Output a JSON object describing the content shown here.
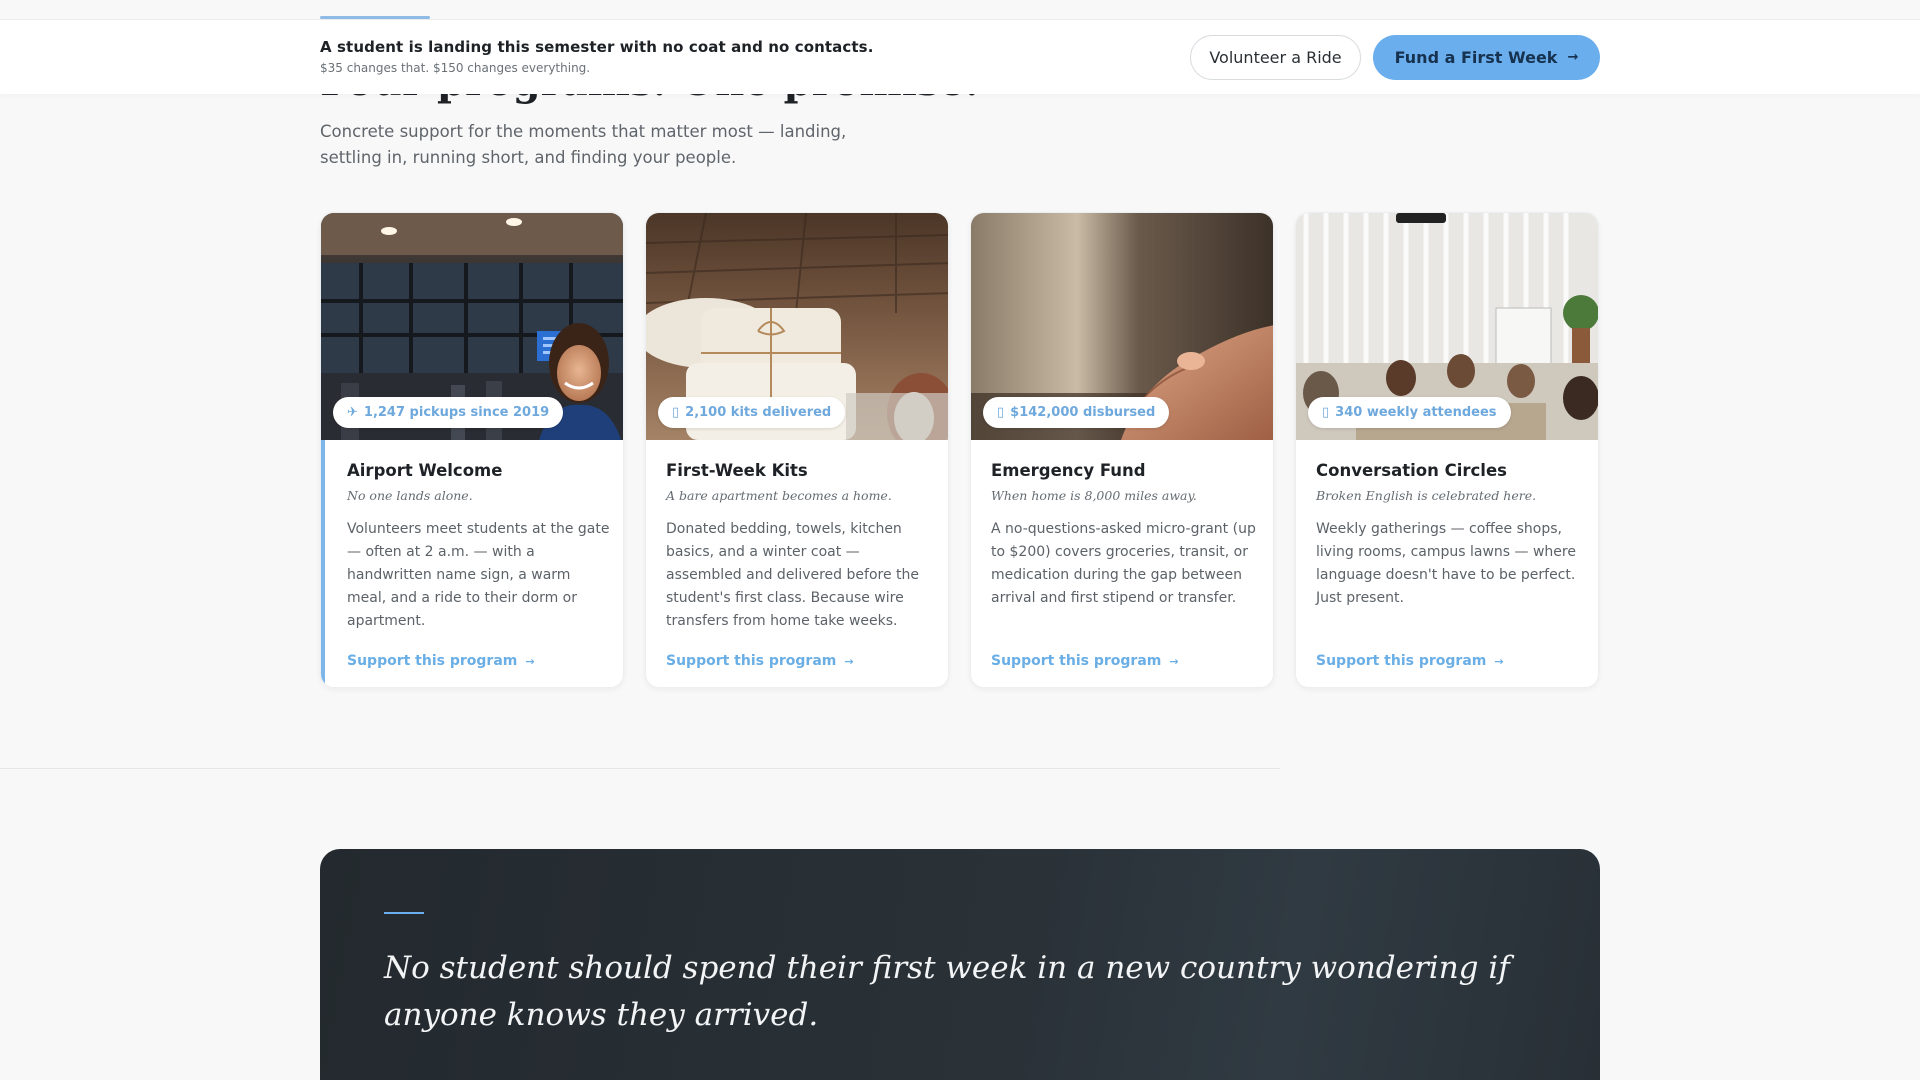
{
  "section": {
    "title": "Four programs. One promise.",
    "subtitle": "Concrete support for the moments that matter most — landing, settling in, running short, and finding your people."
  },
  "topbar": {
    "headline": "A student is landing this semester with no coat and no contacts.",
    "subline": "$35 changes that. $150 changes everything.",
    "volunteer_label": "Volunteer a Ride",
    "fund_label": "Fund a First Week",
    "fund_arrow": "→"
  },
  "programs": [
    {
      "badge_icon": "✈",
      "badge": "1,247 pickups since 2019",
      "title": "Airport Welcome",
      "tagline": "No one lands alone.",
      "description": "Volunteers meet students at the gate — often at 2 a.m. — with a handwritten name sign, a warm meal, and a ride to their dorm or apartment.",
      "link": "Support this program",
      "link_arrow": "→"
    },
    {
      "badge_icon": "▯",
      "badge": "2,100 kits delivered",
      "title": "First-Week Kits",
      "tagline": "A bare apartment becomes a home.",
      "description": "Donated bedding, towels, kitchen basics, and a winter coat — assembled and delivered before the student's first class. Because wire transfers from home take weeks.",
      "link": "Support this program",
      "link_arrow": "→"
    },
    {
      "badge_icon": "▯",
      "badge": "$142,000 disbursed",
      "title": "Emergency Fund",
      "tagline": "When home is 8,000 miles away.",
      "description": "A no-questions-asked micro-grant (up to $200) covers groceries, transit, or medication during the gap between arrival and first stipend or transfer.",
      "link": "Support this program",
      "link_arrow": "→"
    },
    {
      "badge_icon": "▯",
      "badge": "340 weekly attendees",
      "title": "Conversation Circles",
      "tagline": "Broken English is celebrated here.",
      "description": "Weekly gatherings — coffee shops, living rooms, campus lawns — where language doesn't have to be perfect. Just present.",
      "link": "Support this program",
      "link_arrow": "→"
    }
  ],
  "mission": {
    "quote": "No student should spend their first week in a new country wondering if anyone knows they arrived."
  },
  "colors": {
    "accent": "#6aaeee",
    "link": "#6aaee6",
    "dark_panel": "#23292e"
  }
}
